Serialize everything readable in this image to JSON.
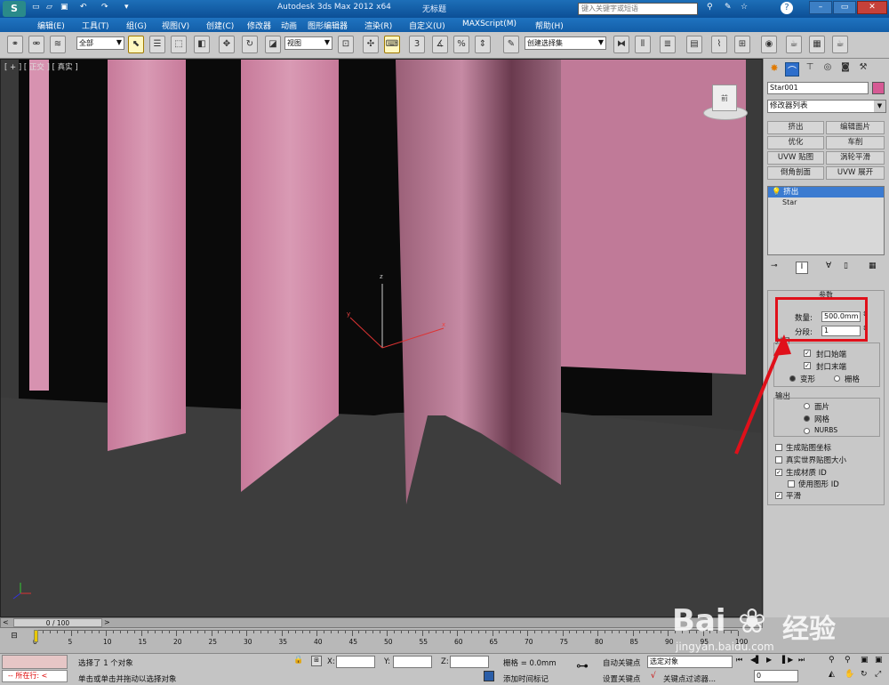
{
  "title_bar": {
    "app_title": "Autodesk 3ds Max  2012 x64",
    "doc_title": "无标题",
    "search_placeholder": "键入关键字或短语"
  },
  "menu": [
    "编辑(E)",
    "工具(T)",
    "组(G)",
    "视图(V)",
    "创建(C)",
    "修改器",
    "动画",
    "图形编辑器",
    "渲染(R)",
    "自定义(U)",
    "MAXScript(M)",
    "帮助(H)"
  ],
  "toolbar": {
    "selection_filter": "全部",
    "ref_coord": "视图",
    "named_selection": "创建选择集",
    "snap_3": "3",
    "snap_pct": "%"
  },
  "viewport": {
    "label": "[ + ] [ 正交 ] [ 真实 ]",
    "axis_x": "x",
    "axis_y": "y",
    "axis_z": "z",
    "cube_label": "前"
  },
  "command_panel": {
    "object_name": "Star001",
    "object_color": "#d65a94",
    "modifier_list": "修改器列表",
    "modifier_buttons": [
      "挤出",
      "编辑面片",
      "优化",
      "车削",
      "UVW 贴图",
      "涡轮平滑",
      "倒角剖面",
      "UVW 展开"
    ],
    "stack": [
      "挤出",
      "Star"
    ],
    "rollout_title": "参数",
    "amount_label": "数量:",
    "amount_value": "500.0mm",
    "segments_label": "分段:",
    "segments_value": "1",
    "capping_title": "封口",
    "cap_start": "封口始端",
    "cap_end": "封口末端",
    "morph": "变形",
    "grid": "栅格",
    "output_title": "输出",
    "output_patch": "面片",
    "output_mesh": "网格",
    "output_nurbs": "NURBS",
    "gen_mapping": "生成贴图坐标",
    "real_world": "真实世界贴图大小",
    "gen_mat_ids": "生成材质 ID",
    "use_shape_ids": "使用图形 ID",
    "smooth": "平滑"
  },
  "timeline": {
    "frame_range": "0 / 100",
    "ticks": [
      "0",
      "5",
      "10",
      "15",
      "20",
      "25",
      "30",
      "35",
      "40",
      "45",
      "50",
      "55",
      "60",
      "65",
      "70",
      "75",
      "80",
      "85",
      "90",
      "95",
      "100"
    ]
  },
  "status": {
    "script_label": "所在行:",
    "selected": "选择了 1 个对象",
    "prompt": "单击或单击并拖动以选择对象",
    "x_label": "X:",
    "y_label": "Y:",
    "z_label": "Z:",
    "grid": "栅格 = 0.0mm",
    "add_time_tag": "添加时间标记",
    "auto_key": "自动关键点",
    "set_key": "设置关键点",
    "selected_set": "选定对象",
    "key_filters": "关键点过滤器...",
    "frame": "0"
  },
  "watermark": {
    "brand": "Bai",
    "brand2": "经验",
    "url": "jingyan.baidu.com"
  }
}
